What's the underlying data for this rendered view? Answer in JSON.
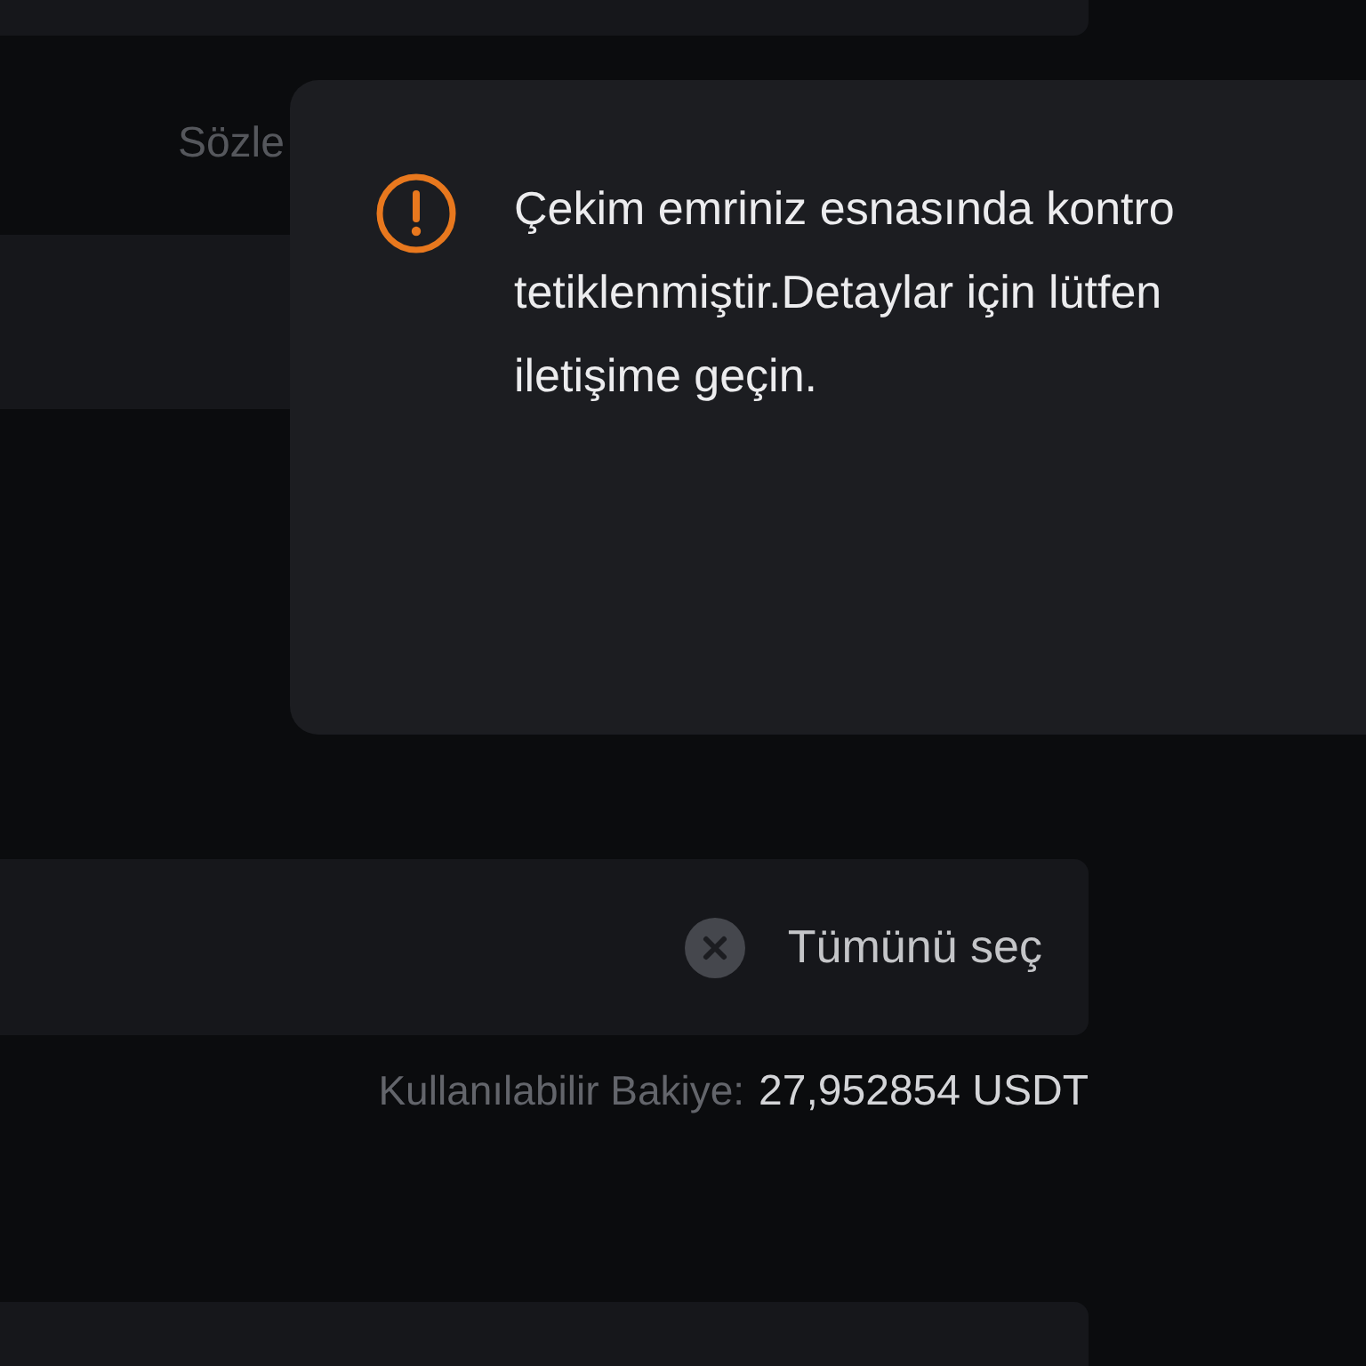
{
  "background": {
    "section_label": "Sözle",
    "amount_field": {
      "select_all": "Tümünü seç"
    },
    "balance": {
      "label": "Kullanılabilir Bakiye:",
      "value": "27,952854 USDT"
    }
  },
  "dialog": {
    "kind": "warning",
    "message_lines": [
      "Çekim emriniz esnasında kontro",
      "tetiklenmiştir.Detaylar için lütfen",
      "iletişime geçin."
    ]
  }
}
